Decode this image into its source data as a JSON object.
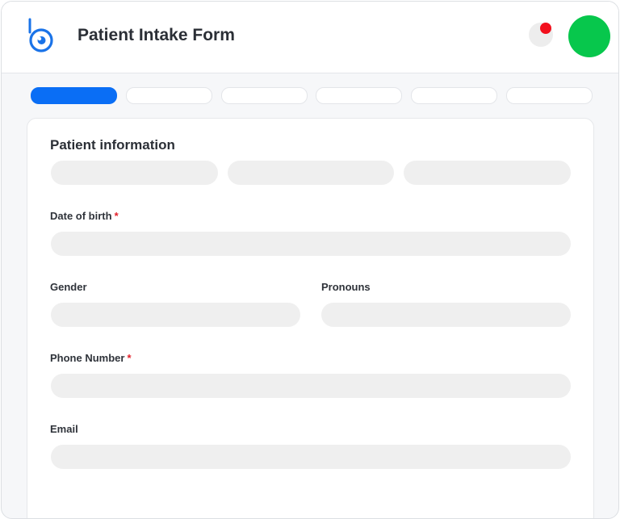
{
  "header": {
    "title": "Patient Intake Form",
    "logo_color": "#1a73e8"
  },
  "notification": {
    "badge_color": "#f2101d"
  },
  "user": {
    "avatar_color": "#07c74c"
  },
  "progress": {
    "total_steps": 6,
    "current_step": 1,
    "active_color": "#0a6ef5"
  },
  "form": {
    "section_title": "Patient information",
    "name_fields": [
      {
        "placeholder": ""
      },
      {
        "placeholder": ""
      },
      {
        "placeholder": ""
      }
    ],
    "date_of_birth": {
      "label": "Date of birth",
      "required_mark": "*",
      "value": ""
    },
    "gender": {
      "label": "Gender",
      "value": ""
    },
    "pronouns": {
      "label": "Pronouns",
      "value": ""
    },
    "phone": {
      "label": "Phone Number",
      "required_mark": "*",
      "value": ""
    },
    "email": {
      "label": "Email",
      "value": ""
    }
  }
}
